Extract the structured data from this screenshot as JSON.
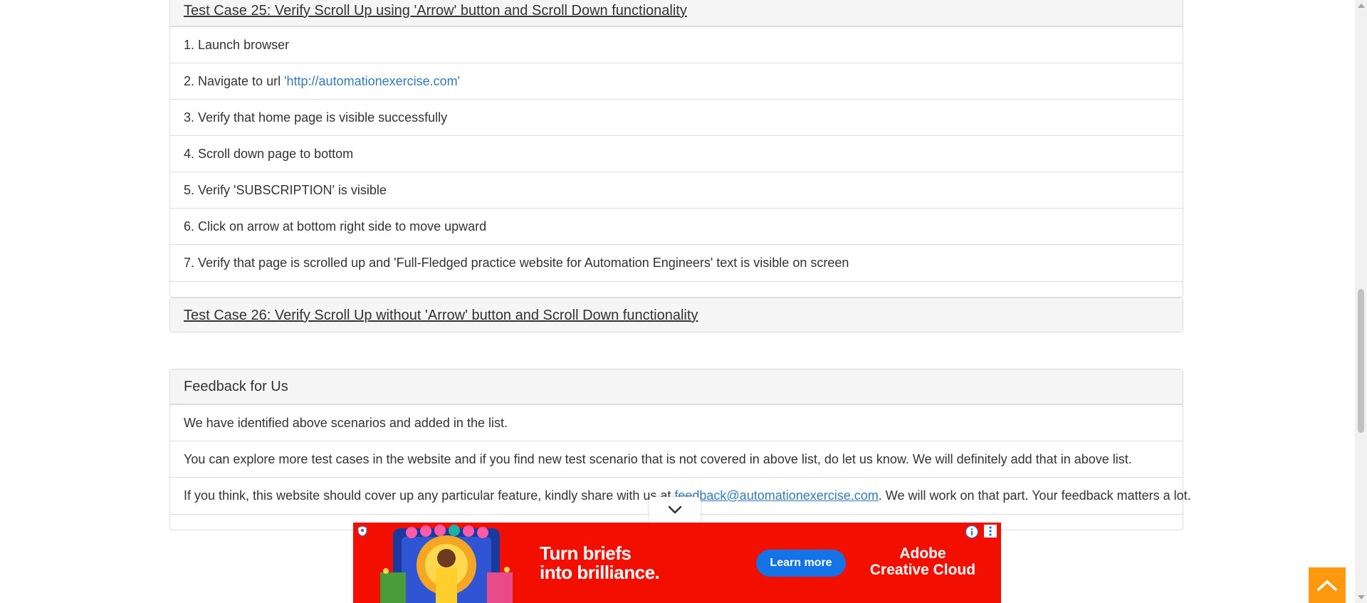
{
  "test_case_25": {
    "title": "Test Case 25: Verify Scroll Up using 'Arrow' button and Scroll Down functionality",
    "steps": [
      "1. Launch browser",
      "2. Navigate to url ",
      "3. Verify that home page is visible successfully",
      "4. Scroll down page to bottom",
      "5. Verify 'SUBSCRIPTION' is visible",
      "6. Click on arrow at bottom right side to move upward",
      "7. Verify that page is scrolled up and 'Full-Fledged practice website for Automation Engineers' text is visible on screen"
    ],
    "url_link": "'http://automationexercise.com'"
  },
  "test_case_26": {
    "title": "Test Case 26: Verify Scroll Up without 'Arrow' button and Scroll Down functionality"
  },
  "feedback": {
    "heading": "Feedback for Us",
    "line1": "We have identified above scenarios and added in the list.",
    "line2": "You can explore more test cases in the website and if you find new test scenario that is not covered in above list, do let us know. We will definitely add that in above list.",
    "line3_before": "If you think, this website should cover up any particular feature, kindly share with us at ",
    "line3_email": "feedback@automationexercise.com",
    "line3_after": ". We will work on that part. Your feedback matters a lot."
  },
  "ad": {
    "headline_1": "Turn briefs",
    "headline_2": "into brilliance.",
    "button": "Learn more",
    "brand_1": "Adobe",
    "brand_2": "Creative Cloud",
    "illustration_icon": "poster-illustration-icon",
    "info_icon": "info-icon",
    "menu_icon": "vertical-dots-icon"
  },
  "icons": {
    "collapse": "chevron-down-icon",
    "scroll_up": "chevron-up-icon"
  },
  "colors": {
    "scroll_up_bg": "#fe980f",
    "ad_bg": "#f20f00",
    "ad_button": "#1473e6",
    "link": "#337ab7"
  }
}
